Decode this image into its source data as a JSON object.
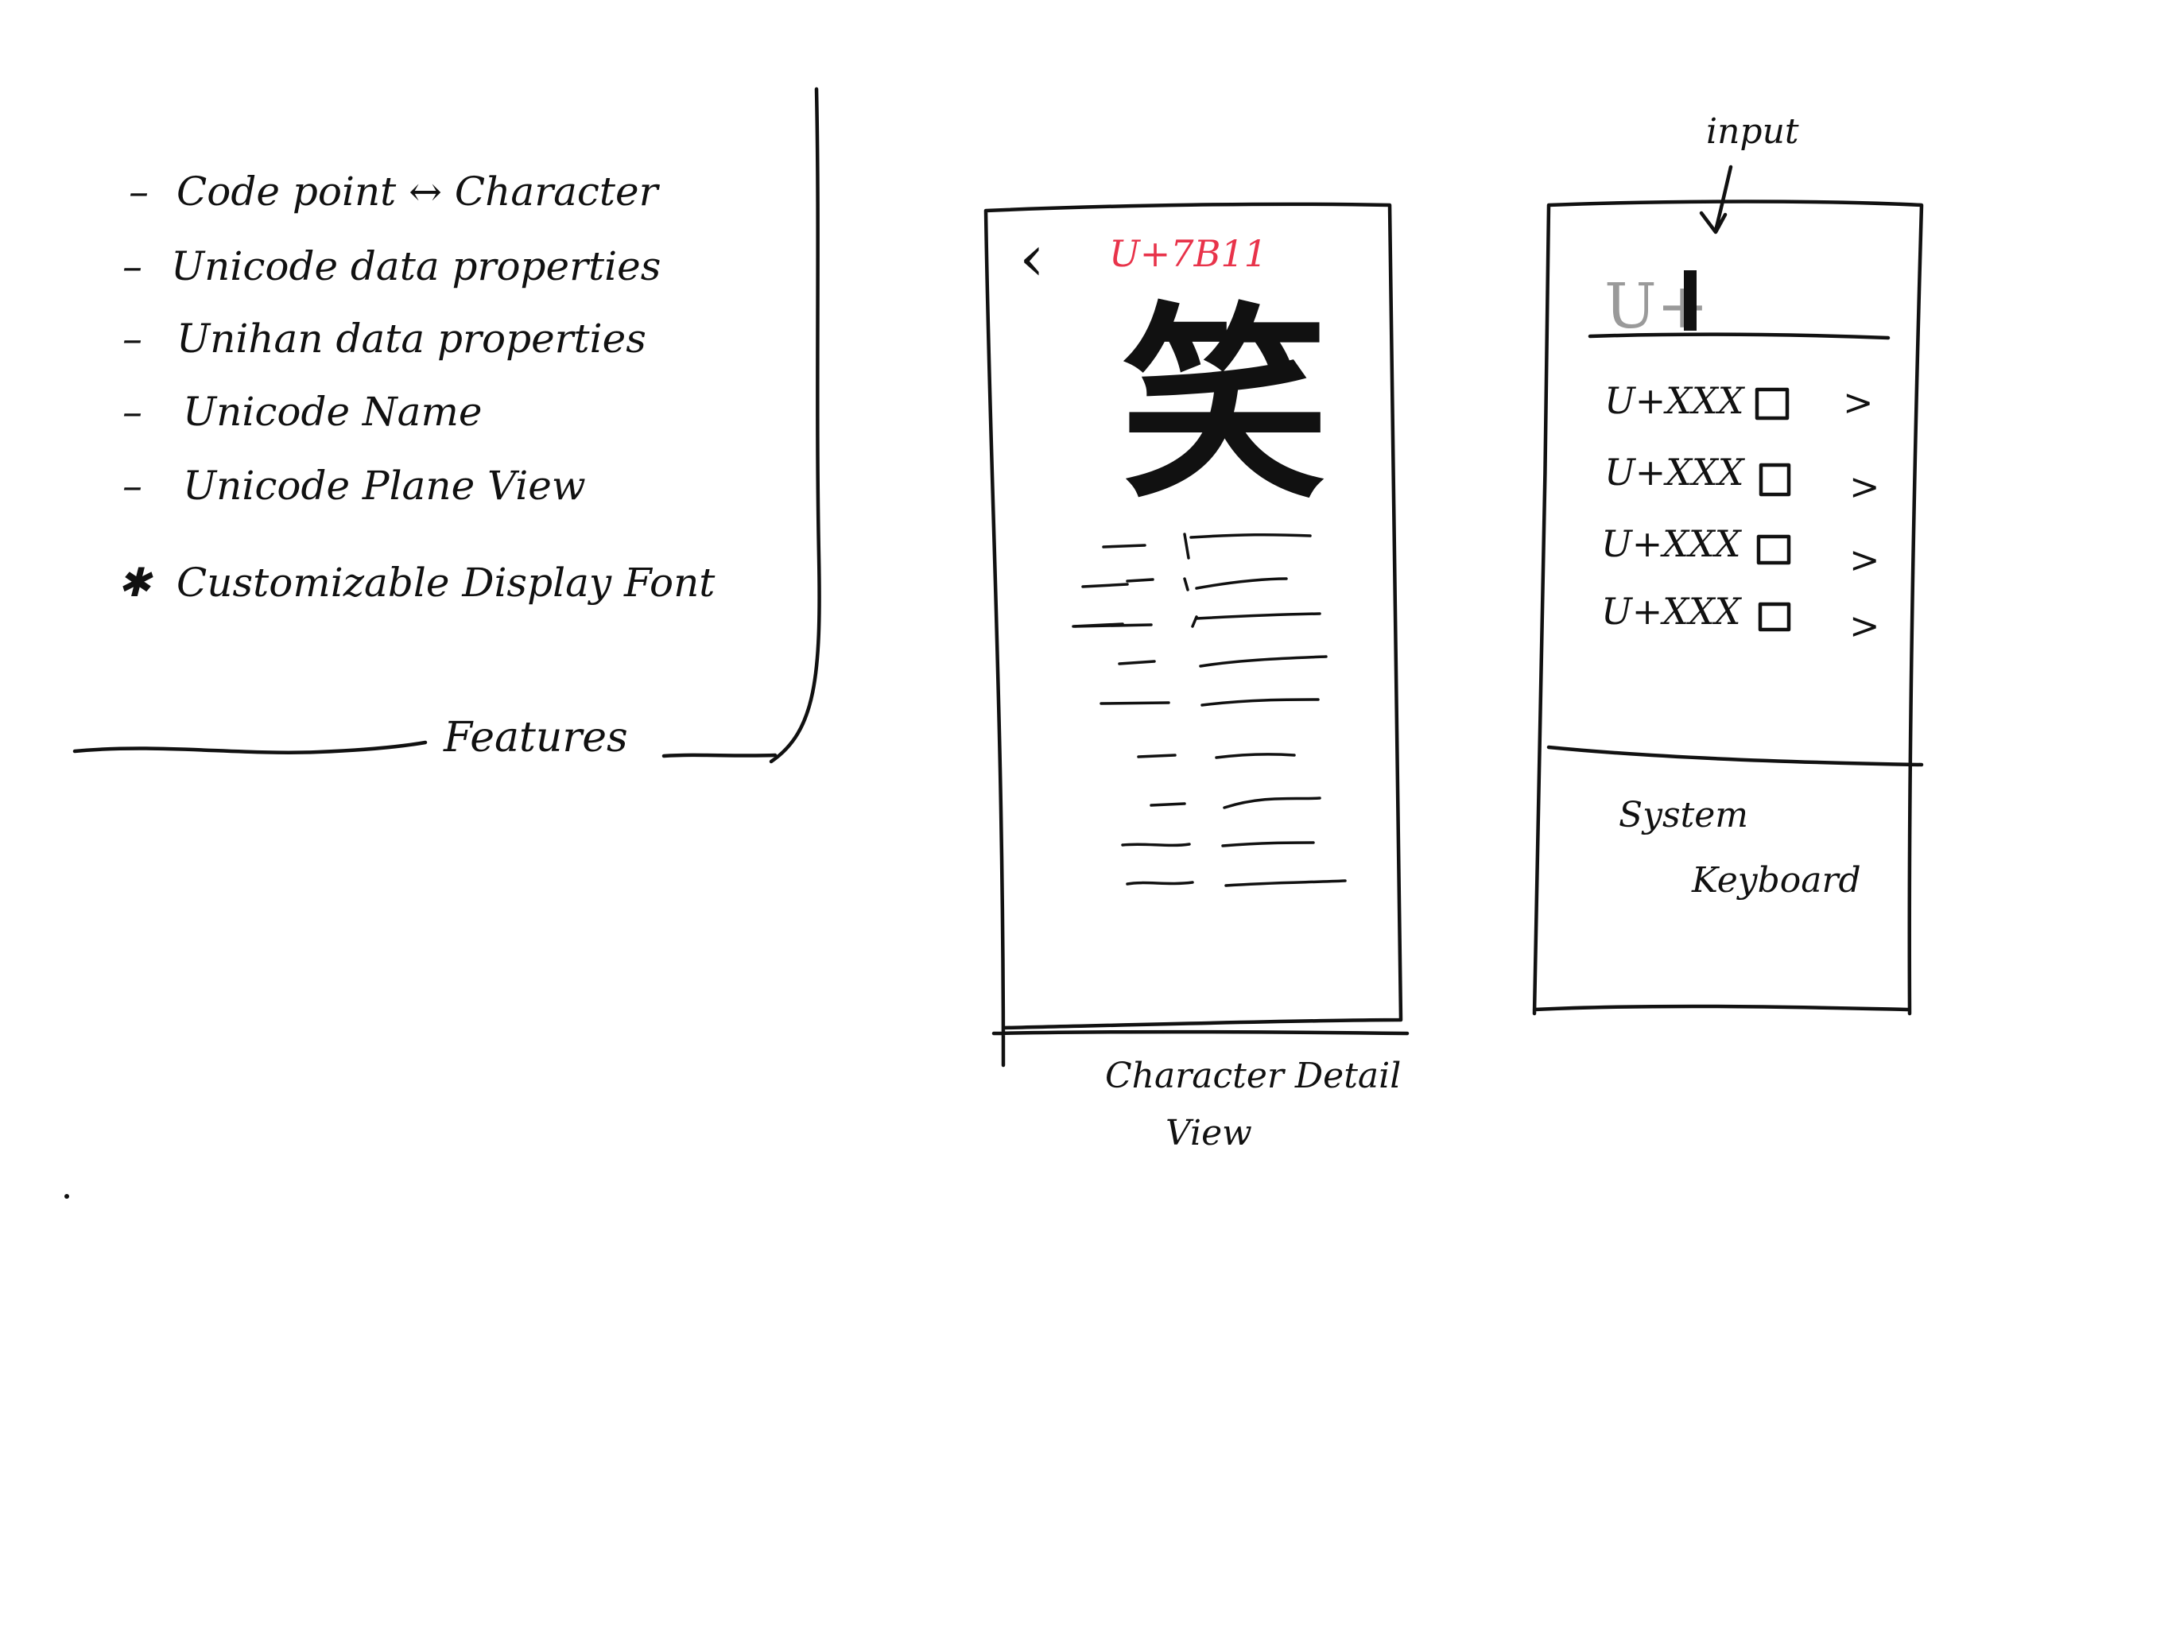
{
  "features": {
    "title": "Features",
    "items": [
      {
        "bullet": "–",
        "text": "Code point ↔ Character"
      },
      {
        "bullet": "–",
        "text": "Unicode data properties"
      },
      {
        "bullet": "–",
        "text": "Unihan data properties"
      },
      {
        "bullet": "–",
        "text": "Unicode Name"
      },
      {
        "bullet": "–",
        "text": "Unicode Plane View"
      },
      {
        "bullet": "✱",
        "text": "Customizable Display Font"
      }
    ]
  },
  "detail_view": {
    "caption": "Character Detail View",
    "back_glyph": "‹",
    "code_point": "U+7B11",
    "character": "笑",
    "accent_color": "#e8334a"
  },
  "input_view": {
    "annotation": "input",
    "prefix": "U+",
    "prefix_color": "#9a9a9a",
    "results": [
      {
        "code": "U+XXX",
        "chevron": ">"
      },
      {
        "code": "U+XXX",
        "chevron": ">"
      },
      {
        "code": "U+XXX",
        "chevron": ">"
      },
      {
        "code": "U+XXX",
        "chevron": ">"
      }
    ],
    "keyboard_label_line1": "System",
    "keyboard_label_line2": "Keyboard"
  }
}
